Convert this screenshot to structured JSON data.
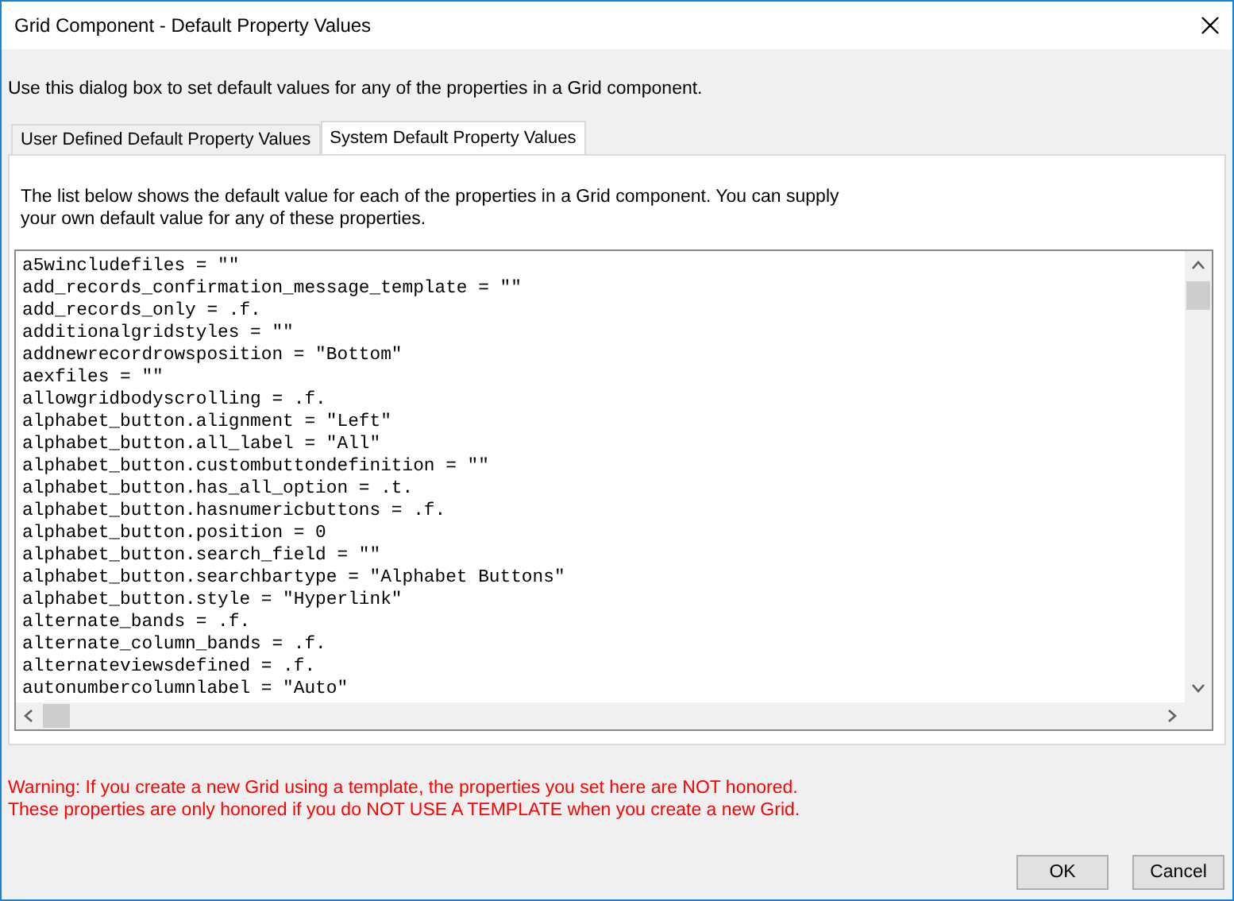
{
  "window": {
    "title": "Grid Component - Default Property Values"
  },
  "intro": "Use this dialog box to set default values for any of the properties in a Grid component.",
  "tabs": [
    {
      "label": "User Defined Default Property Values",
      "selected": false
    },
    {
      "label": "System Default Property Values",
      "selected": true
    }
  ],
  "panel": {
    "description": "The list below shows the default value for each of the properties in a Grid component. You can supply\nyour own default value for any of these properties.",
    "lines": [
      "a5wincludefiles = \"\"",
      "add_records_confirmation_message_template = \"\"",
      "add_records_only = .f.",
      "additionalgridstyles = \"\"",
      "addnewrecordrowsposition = \"Bottom\"",
      "aexfiles = \"\"",
      "allowgridbodyscrolling = .f.",
      "alphabet_button.alignment = \"Left\"",
      "alphabet_button.all_label = \"All\"",
      "alphabet_button.custombuttondefinition = \"\"",
      "alphabet_button.has_all_option = .t.",
      "alphabet_button.hasnumericbuttons = .f.",
      "alphabet_button.position = 0",
      "alphabet_button.search_field = \"\"",
      "alphabet_button.searchbartype = \"Alphabet Buttons\"",
      "alphabet_button.style = \"Hyperlink\"",
      "alternate_bands = .f.",
      "alternate_column_bands = .f.",
      "alternateviewsdefined = .f.",
      "autonumbercolumnlabel = \"Auto\""
    ]
  },
  "warning": "Warning: If you create a new Grid using a template, the properties you set here are NOT honored.\nThese properties are only honored if you do NOT USE A TEMPLATE when you create a new Grid.",
  "buttons": [
    {
      "label": "OK"
    },
    {
      "label": "Cancel"
    }
  ]
}
